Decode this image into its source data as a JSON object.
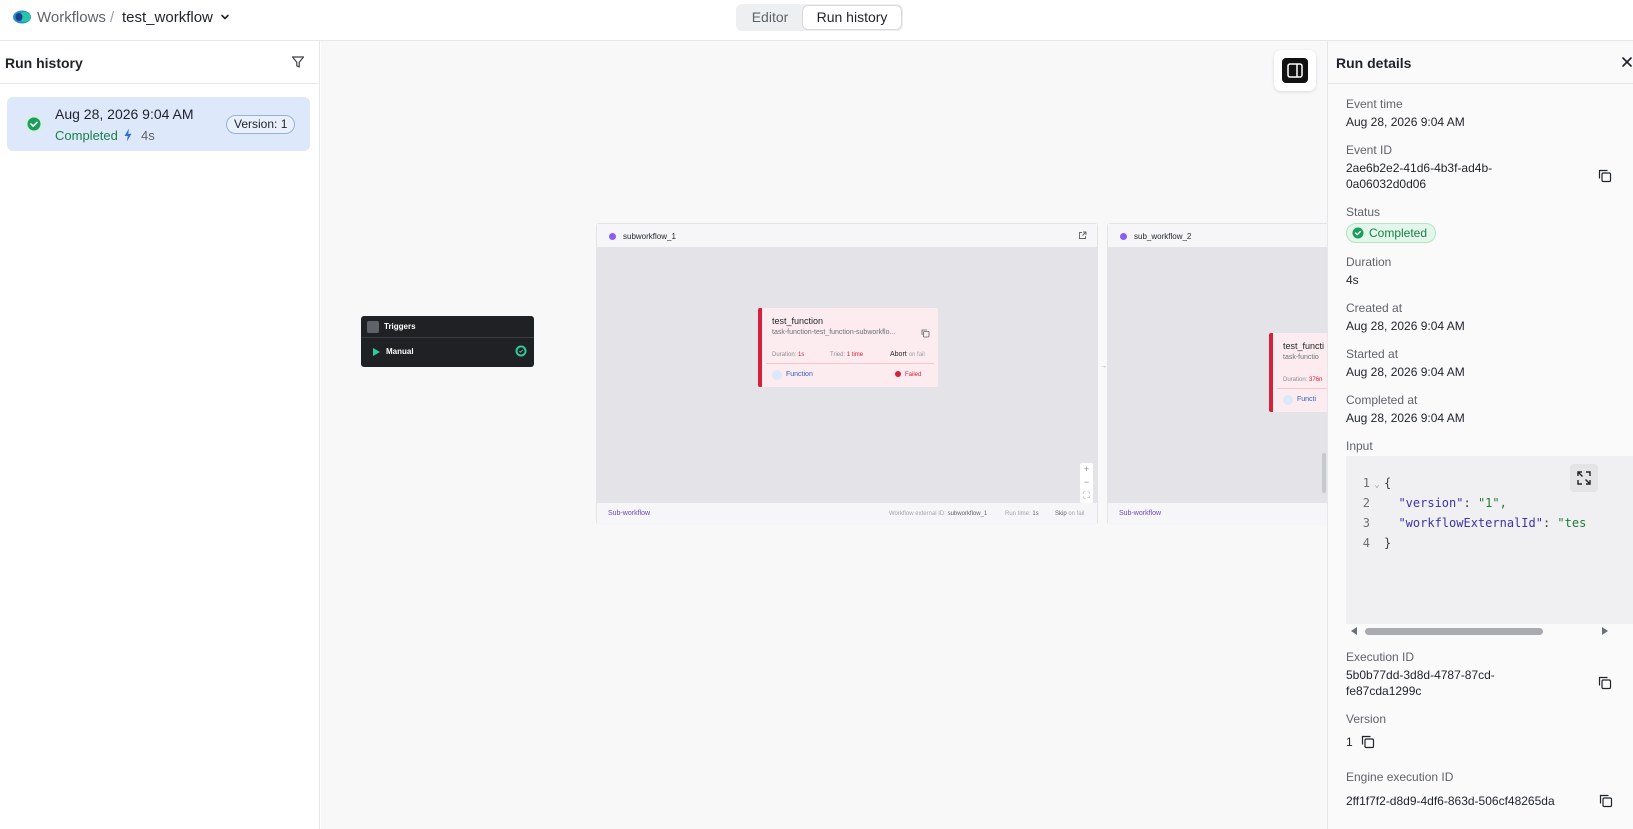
{
  "header": {
    "breadcrumb_root": "Workflows",
    "breadcrumb_sep": "/",
    "workflow_name": "test_workflow",
    "tabs": [
      {
        "label": "Editor",
        "active": false
      },
      {
        "label": "Run history",
        "active": true
      }
    ]
  },
  "left_panel": {
    "title": "Run history",
    "runs": [
      {
        "date": "Aug 28, 2026 9:04 AM",
        "status": "Completed",
        "duration": "4s",
        "version": "Version: 1"
      }
    ]
  },
  "canvas": {
    "trigger": {
      "title": "Triggers",
      "item": "Manual"
    },
    "subworkflows": [
      {
        "name": "subworkflow_1",
        "footer_type": "Sub-workflow",
        "external_id_label": "Workflow external ID:",
        "external_id": "subworkflow_1",
        "run_time_label": "Run time:",
        "run_time": "1s",
        "skip_label": "Skip",
        "skip_suffix": "on fail",
        "task": {
          "name": "test_function",
          "external_id": "task-function-test_function-subworkflo...",
          "duration_label": "Duration:",
          "duration": "1s",
          "tried_label": "Tried:",
          "tried": "1 time",
          "abort_label": "Abort",
          "abort_suffix": "on fail",
          "type": "Function",
          "status": "Failed"
        }
      },
      {
        "name": "sub_workflow_2",
        "footer_type": "Sub-workflow",
        "task": {
          "name": "test_functi",
          "external_id": "task-functio",
          "duration_label": "Duration:",
          "duration": "376n",
          "type": "Functi"
        }
      }
    ],
    "zoom_controls": [
      "+",
      "−",
      "⛶"
    ]
  },
  "details": {
    "title": "Run details",
    "event_time_label": "Event time",
    "event_time": "Aug 28, 2026 9:04 AM",
    "event_id_label": "Event ID",
    "event_id_1": "2ae6b2e2-41d6-4b3f-ad4b-",
    "event_id_2": "0a06032d0d06",
    "status_label": "Status",
    "status": "Completed",
    "duration_label": "Duration",
    "duration": "4s",
    "created_label": "Created at",
    "created": "Aug 28, 2026 9:04 AM",
    "started_label": "Started at",
    "started": "Aug 28, 2026 9:04 AM",
    "completed_label": "Completed at",
    "completed": "Aug 28, 2026 9:04 AM",
    "input_label": "Input",
    "input_lines": [
      {
        "n": "1",
        "fold": "⌄",
        "text": "{"
      },
      {
        "n": "2",
        "fold": "",
        "key": "\"version\"",
        "value": "\"1\","
      },
      {
        "n": "3",
        "fold": "",
        "key": "\"workflowExternalId\"",
        "value": "\"tes"
      },
      {
        "n": "4",
        "fold": "",
        "text": "}"
      }
    ],
    "execution_id_label": "Execution ID",
    "execution_id_1": "5b0b77dd-3d8d-4787-87cd-",
    "execution_id_2": "fe87cda1299c",
    "version_label": "Version",
    "version": "1",
    "engine_id_label": "Engine execution ID",
    "engine_id": "2ff1f7f2-d8d9-4df6-863d-506cf48265da"
  },
  "colors": {
    "accent_blue": "#dde9fb",
    "success_green": "#1a7f4b",
    "failed_red": "#d4213d",
    "subworkflow_purple": "#8b5cf6"
  }
}
